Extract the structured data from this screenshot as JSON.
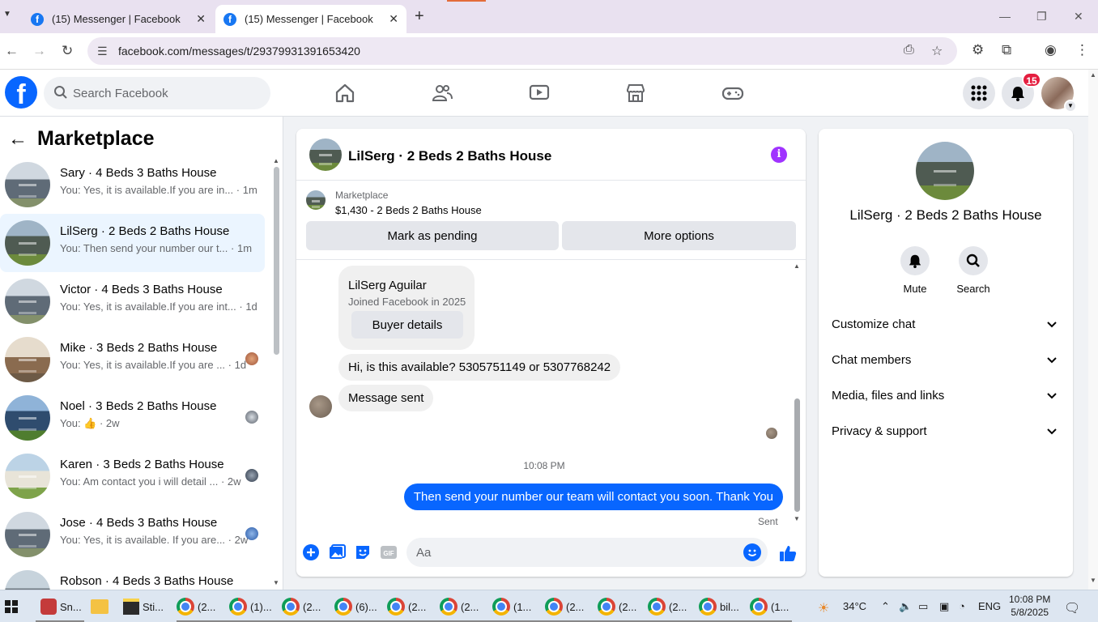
{
  "browser": {
    "tabs": [
      {
        "title": "(15) Messenger | Facebook",
        "active": false
      },
      {
        "title": "(15) Messenger | Facebook",
        "active": true
      }
    ],
    "url": "facebook.com/messages/t/29379931391653420"
  },
  "fb": {
    "search_placeholder": "Search Facebook",
    "notifications_count": "15"
  },
  "sidebar": {
    "title": "Marketplace",
    "conversations": [
      {
        "name": "Sary · 4 Beds 3 Baths House",
        "preview": "You: Yes, it is available.If you are in... · 1m",
        "thumb": "h-slate",
        "selected": false
      },
      {
        "name": "LilSerg · 2 Beds 2 Baths House",
        "preview": "You: Then send your number our t... · 1m",
        "thumb": "h-green",
        "selected": true
      },
      {
        "name": "Victor · 4 Beds 3 Baths House",
        "preview": "You: Yes, it is available.If you are int... · 1d",
        "thumb": "h-slate",
        "selected": false
      },
      {
        "name": "Mike · 3 Beds 2 Baths House",
        "preview": "You: Yes, it is available.If you are ... · 1d",
        "thumb": "h-interior",
        "selected": false
      },
      {
        "name": "Noel · 3 Beds 2 Baths House",
        "preview": "You: 👍 · 2w",
        "thumb": "h-blue",
        "selected": false
      },
      {
        "name": "Karen · 3 Beds 2 Baths House",
        "preview": "You: Am contact you i will detail ... · 2w",
        "thumb": "h-white",
        "selected": false
      },
      {
        "name": "Jose · 4 Beds 3 Baths House",
        "preview": "You: Yes, it is available. If you are... · 2w",
        "thumb": "h-slate",
        "selected": false
      },
      {
        "name": "Robson · 4 Beds 3 Baths House",
        "preview": "",
        "thumb": "h-grey",
        "selected": false
      }
    ]
  },
  "chat": {
    "title": "LilSerg · 2 Beds 2 Baths House",
    "marketplace_label": "Marketplace",
    "listing": "$1,430 - 2 Beds 2 Baths House",
    "mark_pending": "Mark as pending",
    "more_options": "More options",
    "card_name": "LilSerg Aguilar",
    "card_joined": "Joined Facebook in 2025",
    "buyer_details": "Buyer details",
    "msg_in_1": "Hi, is this available? 5305751149 or 5307768242",
    "msg_in_2": "Message sent",
    "timestamp": "10:08 PM",
    "msg_out": "Then send your number our team will contact you soon. Thank You",
    "status": "Sent",
    "composer_placeholder": "Aa"
  },
  "info": {
    "name": "LilSerg · 2 Beds 2 Baths House",
    "actions": [
      "Mute",
      "Search"
    ],
    "sections": [
      "Customize chat",
      "Chat members",
      "Media, files and links",
      "Privacy & support"
    ]
  },
  "taskbar": {
    "items": [
      "Sn...",
      "Sti...",
      "(2...",
      "(1)...",
      "(2...",
      "(6)...",
      "(2...",
      "(2...",
      "(1...",
      "(2...",
      "(2...",
      "(2...",
      "bil...",
      "(1..."
    ],
    "temperature": "34°C",
    "language": "ENG",
    "time": "10:08 PM",
    "date": "5/8/2025"
  },
  "colors": {
    "fb_blue": "#0866ff",
    "selected_row": "#ebf5ff",
    "info_purple": "#a033ff",
    "badge_red": "#e41e3f"
  }
}
